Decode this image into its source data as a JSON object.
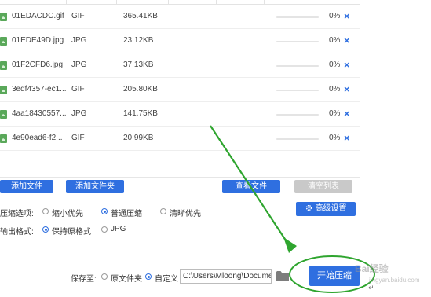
{
  "files": [
    {
      "name": "01EDACDC.gif",
      "type": "GIF",
      "size": "365.41KB",
      "progress": 0,
      "percent": "0%"
    },
    {
      "name": "01EDE49D.jpg",
      "type": "JPG",
      "size": "23.12KB",
      "progress": 0,
      "percent": "0%"
    },
    {
      "name": "01F2CFD6.jpg",
      "type": "JPG",
      "size": "37.13KB",
      "progress": 0,
      "percent": "0%"
    },
    {
      "name": "3edf4357-ec1...",
      "type": "GIF",
      "size": "205.80KB",
      "progress": 0,
      "percent": "0%"
    },
    {
      "name": "4aa18430557...",
      "type": "JPG",
      "size": "141.75KB",
      "progress": 0,
      "percent": "0%"
    },
    {
      "name": "4e90ead6-f2...",
      "type": "GIF",
      "size": "20.99KB",
      "progress": 0,
      "percent": "0%"
    }
  ],
  "remove_symbol": "×",
  "buttons": {
    "add_file": "添加文件",
    "add_folder": "添加文件夹",
    "view_file": "查看文件",
    "clear_list": "清空列表",
    "advanced": "高级设置",
    "start": "开始压缩"
  },
  "compress_option": {
    "label": "压缩选项:",
    "choices": [
      "缩小优先",
      "普通压缩",
      "清晰优先"
    ],
    "selected": 1
  },
  "output_format": {
    "label": "输出格式:",
    "choices": [
      "保持原格式",
      "JPG"
    ],
    "selected": 0
  },
  "save_to": {
    "label": "保存至:",
    "choices": [
      "原文件夹",
      "自定义"
    ],
    "selected": 1,
    "path": "C:\\Users\\Mloong\\Docume"
  },
  "watermark": {
    "text": "Bai经验",
    "sub": "jingyan.baidu.com"
  },
  "colors": {
    "accent": "#2f6fe0",
    "annotation": "#2fa52f",
    "disabled": "#c9c9c9"
  }
}
